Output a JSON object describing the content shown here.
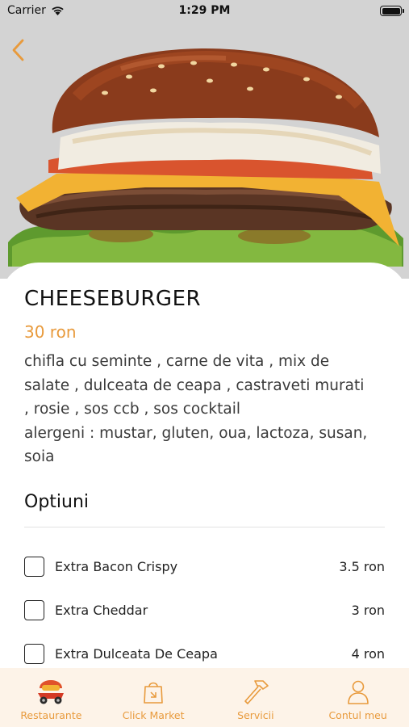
{
  "status_bar": {
    "carrier": "Carrier",
    "time": "1:29 PM"
  },
  "product": {
    "name": "CHEESEBURGER",
    "price": "30 ron",
    "description_lines": [
      "chifla cu seminte , carne de vita , mix de",
      "salate , dulceata de ceapa , castraveti murati",
      ", rosie , sos ccb , sos cocktail",
      "alergeni : mustar, gluten, oua, lactoza, susan,",
      "soia"
    ]
  },
  "options_section": {
    "title": "Optiuni",
    "items": [
      {
        "label": "Extra Bacon Crispy",
        "price": "3.5 ron",
        "checked": false
      },
      {
        "label": "Extra Cheddar",
        "price": "3 ron",
        "checked": false
      },
      {
        "label": "Extra Dulceata De Ceapa",
        "price": "4 ron",
        "checked": false
      }
    ]
  },
  "tab_bar": {
    "items": [
      {
        "label": "Restaurante",
        "icon": "scooter-icon"
      },
      {
        "label": "Click Market",
        "icon": "shopping-bag-icon"
      },
      {
        "label": "Servicii",
        "icon": "hammer-icon"
      },
      {
        "label": "Contul meu",
        "icon": "user-icon"
      }
    ]
  },
  "colors": {
    "accent": "#e89a3c",
    "hero_background": "#d3d3d3",
    "tab_bar_background": "#fdf3e8"
  }
}
